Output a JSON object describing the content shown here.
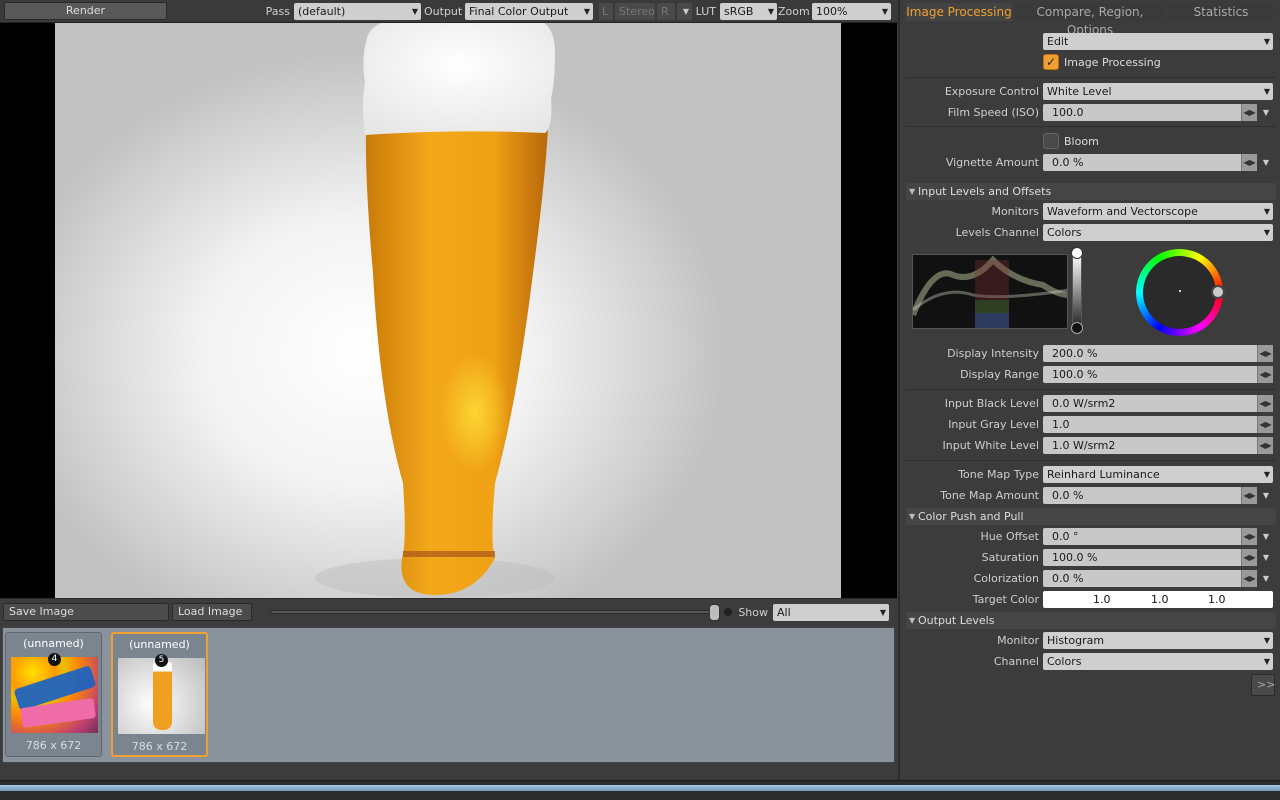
{
  "toolbar": {
    "render_label": "Render",
    "pass_label": "Pass",
    "pass_value": "(default)",
    "output_label": "Output",
    "output_value": "Final Color Output",
    "l_label": "L",
    "stereo_label": "Stereo",
    "r_label": "R",
    "lut_label": "LUT",
    "lut_value": "sRGB",
    "zoom_label": "Zoom",
    "zoom_value": "100%"
  },
  "bottom_bar": {
    "save_label": "Save Image",
    "load_label": "Load Image",
    "show_label": "Show",
    "show_value": "All"
  },
  "thumbnails": [
    {
      "title": "(unnamed)",
      "badge": "4",
      "dims": "786 x 672",
      "selected": false
    },
    {
      "title": "(unnamed)",
      "badge": "5",
      "dims": "786 x 672",
      "selected": true
    }
  ],
  "tabs": [
    "Image Processing",
    "Compare, Region, Options",
    "Statistics"
  ],
  "panel": {
    "edit_value": "Edit",
    "image_processing_label": "Image Processing",
    "image_processing_checked": true,
    "exposure_control_label": "Exposure Control",
    "exposure_control_value": "White Level",
    "film_speed_label": "Film Speed (ISO)",
    "film_speed_value": "100.0",
    "bloom_label": "Bloom",
    "bloom_checked": false,
    "vignette_label": "Vignette Amount",
    "vignette_value": "0.0 %",
    "section_input_levels": "Input Levels and Offsets",
    "monitors_label": "Monitors",
    "monitors_value": "Waveform and Vectorscope",
    "levels_channel_label": "Levels Channel",
    "levels_channel_value": "Colors",
    "display_intensity_label": "Display Intensity",
    "display_intensity_value": "200.0 %",
    "display_range_label": "Display Range",
    "display_range_value": "100.0 %",
    "input_black_label": "Input Black Level",
    "input_black_value": "0.0 W/srm2",
    "input_gray_label": "Input Gray Level",
    "input_gray_value": "1.0",
    "input_white_label": "Input White Level",
    "input_white_value": "1.0 W/srm2",
    "tone_map_type_label": "Tone Map Type",
    "tone_map_type_value": "Reinhard Luminance",
    "tone_map_amount_label": "Tone Map Amount",
    "tone_map_amount_value": "0.0 %",
    "section_color_push": "Color Push and Pull",
    "hue_offset_label": "Hue Offset",
    "hue_offset_value": "0.0 °",
    "saturation_label": "Saturation",
    "saturation_value": "100.0 %",
    "colorization_label": "Colorization",
    "colorization_value": "0.0 %",
    "target_color_label": "Target Color",
    "target_color_r": "1.0",
    "target_color_g": "1.0",
    "target_color_b": "1.0",
    "section_output_levels": "Output Levels",
    "monitor_label": "Monitor",
    "monitor_value": "Histogram",
    "channel_label": "Channel",
    "channel_value": "Colors",
    "expand_label": ">>"
  },
  "colors": {
    "accent": "#f0a030",
    "panel_bg": "#3c3c3c",
    "field_bg": "#c8c8c8"
  }
}
